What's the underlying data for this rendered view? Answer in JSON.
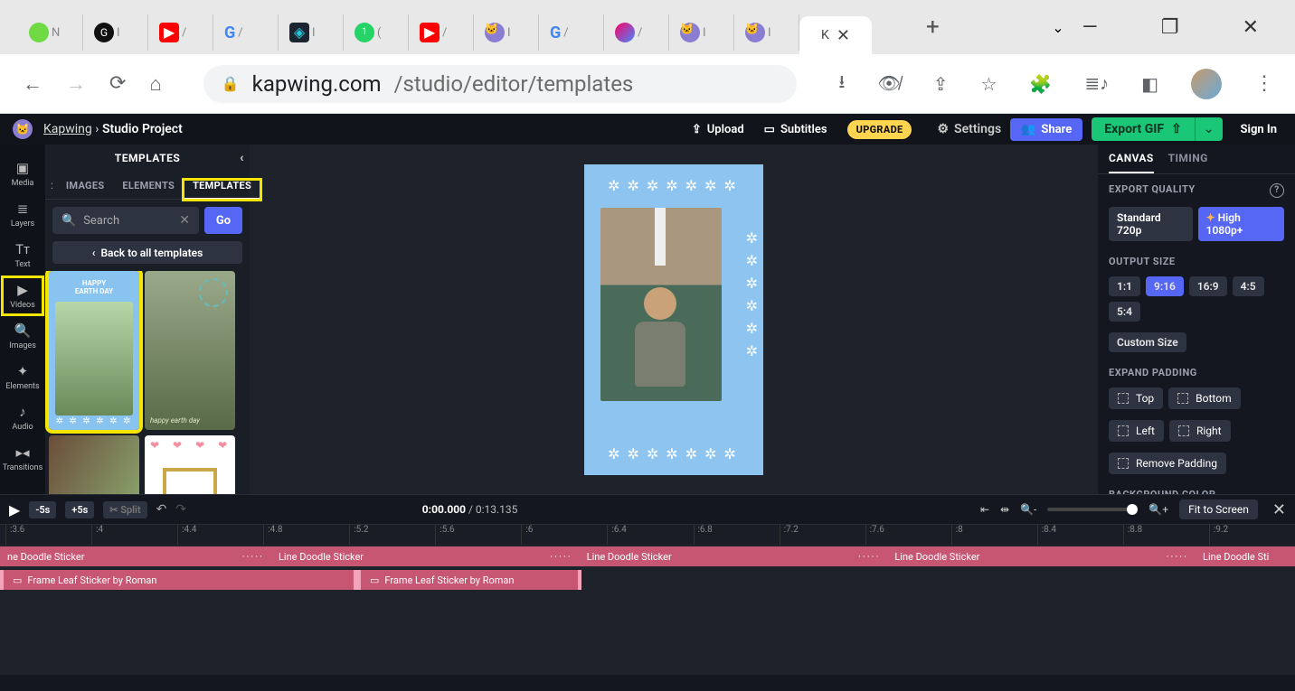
{
  "browser": {
    "active_tab_letter": "K",
    "new_tab": "+",
    "url_domain": "kapwing.com",
    "url_path": "/studio/editor/templates"
  },
  "header": {
    "brand": "Kapwing",
    "project": "Studio Project",
    "sep": "›",
    "upload": "Upload",
    "subtitles": "Subtitles",
    "upgrade": "UPGRADE",
    "settings": "Settings",
    "share": "Share",
    "export": "Export GIF",
    "signin": "Sign In"
  },
  "rail": [
    {
      "label": "Media",
      "icon": "▣"
    },
    {
      "label": "Layers",
      "icon": "≣"
    },
    {
      "label": "Text",
      "icon": "Tᴛ"
    },
    {
      "label": "Videos",
      "icon": "▶"
    },
    {
      "label": "Images",
      "icon": "🔍"
    },
    {
      "label": "Elements",
      "icon": "✦"
    },
    {
      "label": "Audio",
      "icon": "♪"
    },
    {
      "label": "Transitions",
      "icon": "▸◂"
    }
  ],
  "sidepanel": {
    "title": "TEMPLATES",
    "tabs": [
      "IMAGES",
      "ELEMENTS",
      "TEMPLATES"
    ],
    "search_placeholder": "Search",
    "go": "Go",
    "back": "Back to all templates",
    "earth_title_line1": "HAPPY",
    "earth_title_line2": "EARTH DAY",
    "family_caption": "happy earth day"
  },
  "rpanel": {
    "tabs": [
      "CANVAS",
      "TIMING"
    ],
    "export_quality": "EXPORT QUALITY",
    "std": "Standard 720p",
    "high": "High 1080p+",
    "output_size": "OUTPUT SIZE",
    "ratios": [
      "1:1",
      "9:16",
      "16:9",
      "4:5",
      "5:4"
    ],
    "custom": "Custom Size",
    "expand": "EXPAND PADDING",
    "pad": {
      "top": "Top",
      "bottom": "Bottom",
      "left": "Left",
      "right": "Right",
      "remove": "Remove Padding"
    },
    "bgc": "BACKGROUND COLOR",
    "bgc_hex": "#90CAF9",
    "palette": [
      "#000000",
      "#ffffff",
      "#f44336",
      "#ffd600",
      "#1e88e5",
      "#00acc1",
      "#e0e0e0"
    ]
  },
  "timeline": {
    "minus5": "-5s",
    "plus5": "+5s",
    "split": "Split",
    "current": "0:00.000",
    "total": "0:13.135",
    "fit": "Fit to Screen",
    "ticks": [
      ":3.6",
      ":4",
      ":4.4",
      ":4.8",
      ":5.2",
      ":5.6",
      ":6",
      ":6.4",
      ":6.8",
      ":7.2",
      ":7.6",
      ":8",
      ":8.4",
      ":8.8",
      ":9.2"
    ],
    "doodle": "Line Doodle Sticker",
    "doodle_short": "ne Doodle Sticker",
    "doodle_cut": "Line Doodle Sti",
    "frame": "Frame Leaf Sticker by Roman"
  }
}
